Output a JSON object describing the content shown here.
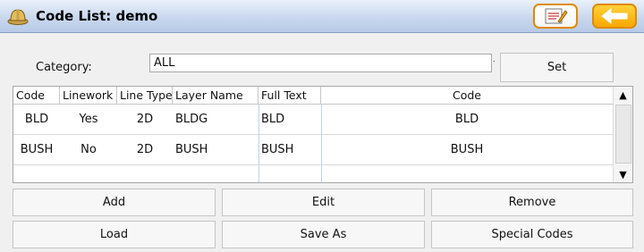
{
  "window": {
    "title": "Code List: demo"
  },
  "toolbar": {
    "notes_icon": "notepad-icon",
    "back_icon": "back-arrow-icon"
  },
  "category": {
    "label": "Category:",
    "value": "ALL",
    "set_label": "Set"
  },
  "table": {
    "columns": [
      "Code",
      "Linework",
      "Line Type",
      "Layer Name",
      "Full Text",
      "Code"
    ],
    "rows": [
      [
        "BLD",
        "Yes",
        "2D",
        "BLDG",
        "BLD",
        "BLD"
      ],
      [
        "BUSH",
        "No",
        "2D",
        "BUSH",
        "BUSH",
        "BUSH"
      ]
    ]
  },
  "buttons": {
    "add": "Add",
    "edit": "Edit",
    "remove": "Remove",
    "load": "Load",
    "save_as": "Save As",
    "special_codes": "Special Codes"
  },
  "colors": {
    "accent_border": "#e08a00",
    "title_bar": "#c9d8ee"
  }
}
